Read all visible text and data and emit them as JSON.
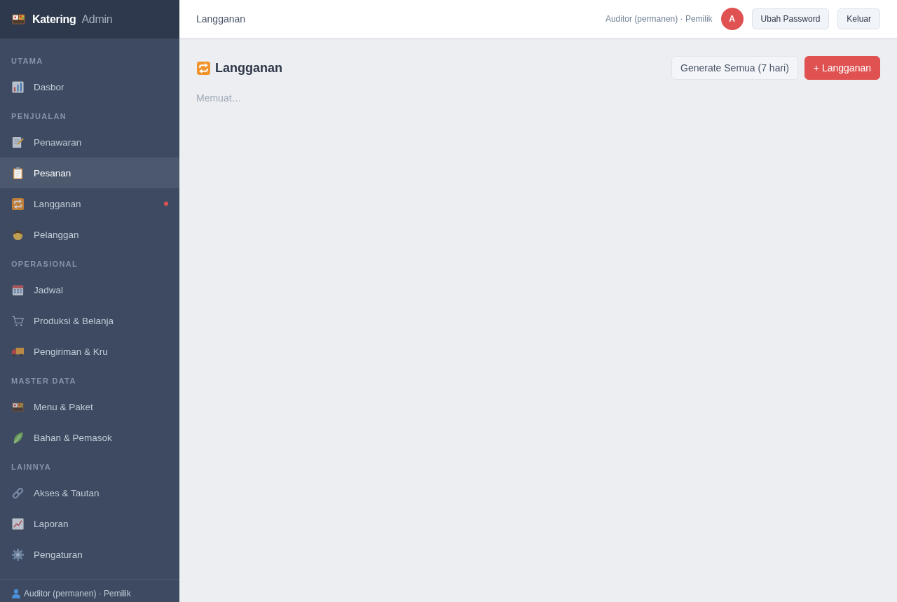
{
  "brand": {
    "name": "Katering",
    "suffix": "Admin"
  },
  "sidebar": {
    "sections": [
      {
        "title": "UTAMA",
        "items": [
          {
            "label": "Dasbor",
            "selected": false,
            "dot": false
          }
        ]
      },
      {
        "title": "PENJUALAN",
        "items": [
          {
            "label": "Penawaran",
            "selected": false,
            "dot": false
          },
          {
            "label": "Pesanan",
            "selected": true,
            "dot": false
          },
          {
            "label": "Langganan",
            "selected": false,
            "dot": true
          },
          {
            "label": "Pelanggan",
            "selected": false,
            "dot": false
          }
        ]
      },
      {
        "title": "OPERASIONAL",
        "items": [
          {
            "label": "Jadwal",
            "selected": false,
            "dot": false
          },
          {
            "label": "Produksi & Belanja",
            "selected": false,
            "dot": false
          },
          {
            "label": "Pengiriman & Kru",
            "selected": false,
            "dot": false
          }
        ]
      },
      {
        "title": "MASTER DATA",
        "items": [
          {
            "label": "Menu & Paket",
            "selected": false,
            "dot": false
          },
          {
            "label": "Bahan & Pemasok",
            "selected": false,
            "dot": false
          }
        ]
      },
      {
        "title": "LAINNYA",
        "items": [
          {
            "label": "Akses & Tautan",
            "selected": false,
            "dot": false
          },
          {
            "label": "Laporan",
            "selected": false,
            "dot": false
          },
          {
            "label": "Pengaturan",
            "selected": false,
            "dot": false
          }
        ]
      }
    ],
    "footer": "Auditor (permanen) · Pemilik"
  },
  "topbar": {
    "breadcrumb": "Langganan",
    "user": "Auditor (permanen) · Pemilik",
    "avatar": "A",
    "buttons": [
      "Ubah Password",
      "Keluar"
    ]
  },
  "page": {
    "title": "Langganan",
    "actions": [
      {
        "label": "Generate Semua (7 hari)",
        "kind": "secondary"
      },
      {
        "label": "+ Langganan",
        "kind": "primary"
      }
    ],
    "status": "Memuat…"
  }
}
